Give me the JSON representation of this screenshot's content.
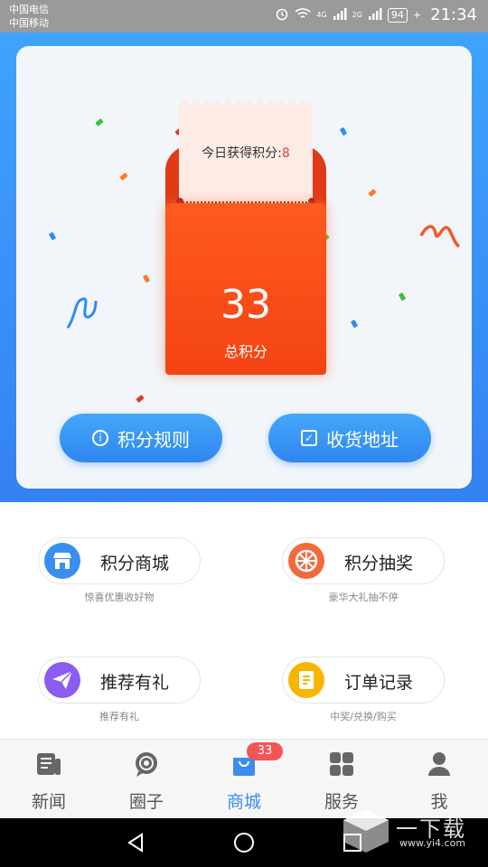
{
  "status_bar": {
    "carrier1": "中国电信",
    "carrier2": "中国移动",
    "signal_tag1": "4G",
    "signal_tag2": "2G",
    "signal_tag3": "2G",
    "battery": "94",
    "time": "21:34"
  },
  "points_card": {
    "today_label": "今日获得积分:",
    "today_value": "8",
    "total_value": "33",
    "total_label": "总积分",
    "rules_button": "积分规则",
    "address_button": "收货地址"
  },
  "features": [
    {
      "label": "积分商城",
      "sub": "惊喜优惠收好物",
      "icon": "shop-icon",
      "color": "#3a8ef0"
    },
    {
      "label": "积分抽奖",
      "sub": "豪华大礼抽不停",
      "icon": "wheel-icon",
      "color": "#f26a3a"
    },
    {
      "label": "推荐有礼",
      "sub": "推荐有礼",
      "icon": "paper-plane-icon",
      "color": "#8a5cf0"
    },
    {
      "label": "订单记录",
      "sub": "中奖/兑换/购买",
      "icon": "order-icon",
      "color": "#f7b500"
    }
  ],
  "bottom_nav": {
    "items": [
      {
        "label": "新闻",
        "icon": "news-icon"
      },
      {
        "label": "圈子",
        "icon": "circle-chat-icon"
      },
      {
        "label": "商城",
        "icon": "shopping-bag-icon",
        "badge": "33",
        "active": true
      },
      {
        "label": "服务",
        "icon": "grid-icon"
      },
      {
        "label": "我",
        "icon": "person-icon"
      }
    ]
  },
  "watermark": {
    "title": "一下载",
    "url": "www.yi4.com"
  },
  "colors": {
    "accent": "#3a8ef0",
    "envelope": "#f44314",
    "badge": "#f25555"
  }
}
